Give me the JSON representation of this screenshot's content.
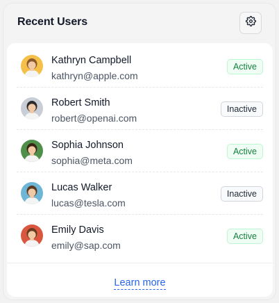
{
  "header": {
    "title": "Recent Users",
    "settings_icon": "gear-icon"
  },
  "users": [
    {
      "name": "Kathryn Campbell",
      "email": "kathryn@apple.com",
      "status": "Active",
      "avatar_bg": "#f5c04a",
      "hair": "#8a5a2b"
    },
    {
      "name": "Robert Smith",
      "email": "robert@openai.com",
      "status": "Inactive",
      "avatar_bg": "#c9ced6",
      "hair": "#2b2b2b"
    },
    {
      "name": "Sophia Johnson",
      "email": "sophia@meta.com",
      "status": "Active",
      "avatar_bg": "#4f8f4a",
      "hair": "#3a2416"
    },
    {
      "name": "Lucas Walker",
      "email": "lucas@tesla.com",
      "status": "Inactive",
      "avatar_bg": "#6fb6d6",
      "hair": "#5a3a22"
    },
    {
      "name": "Emily Davis",
      "email": "emily@sap.com",
      "status": "Active",
      "avatar_bg": "#d9573f",
      "hair": "#6b3a1f"
    }
  ],
  "footer": {
    "link_label": "Learn more"
  },
  "colors": {
    "active_text": "#15803d",
    "inactive_text": "#1f2937",
    "link": "#2563eb"
  }
}
